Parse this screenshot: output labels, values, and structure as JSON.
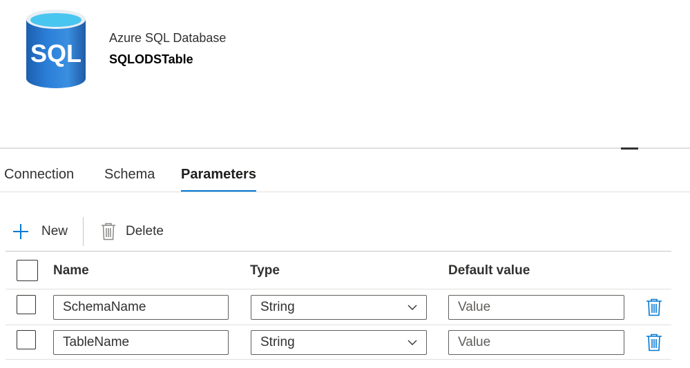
{
  "header": {
    "icon_text": "SQL",
    "dataset_type": "Azure SQL Database",
    "dataset_name": "SQLODSTable"
  },
  "tabs": [
    {
      "label": "Connection",
      "active": false
    },
    {
      "label": "Schema",
      "active": false
    },
    {
      "label": "Parameters",
      "active": true
    }
  ],
  "toolbar": {
    "new_label": "New",
    "delete_label": "Delete"
  },
  "grid": {
    "columns": [
      "Name",
      "Type",
      "Default value"
    ],
    "rows": [
      {
        "name": "SchemaName",
        "type": "String",
        "default_placeholder": "Value"
      },
      {
        "name": "TableName",
        "type": "String",
        "default_placeholder": "Value"
      }
    ]
  },
  "colors": {
    "accent": "#0078d4",
    "text": "#323130"
  }
}
